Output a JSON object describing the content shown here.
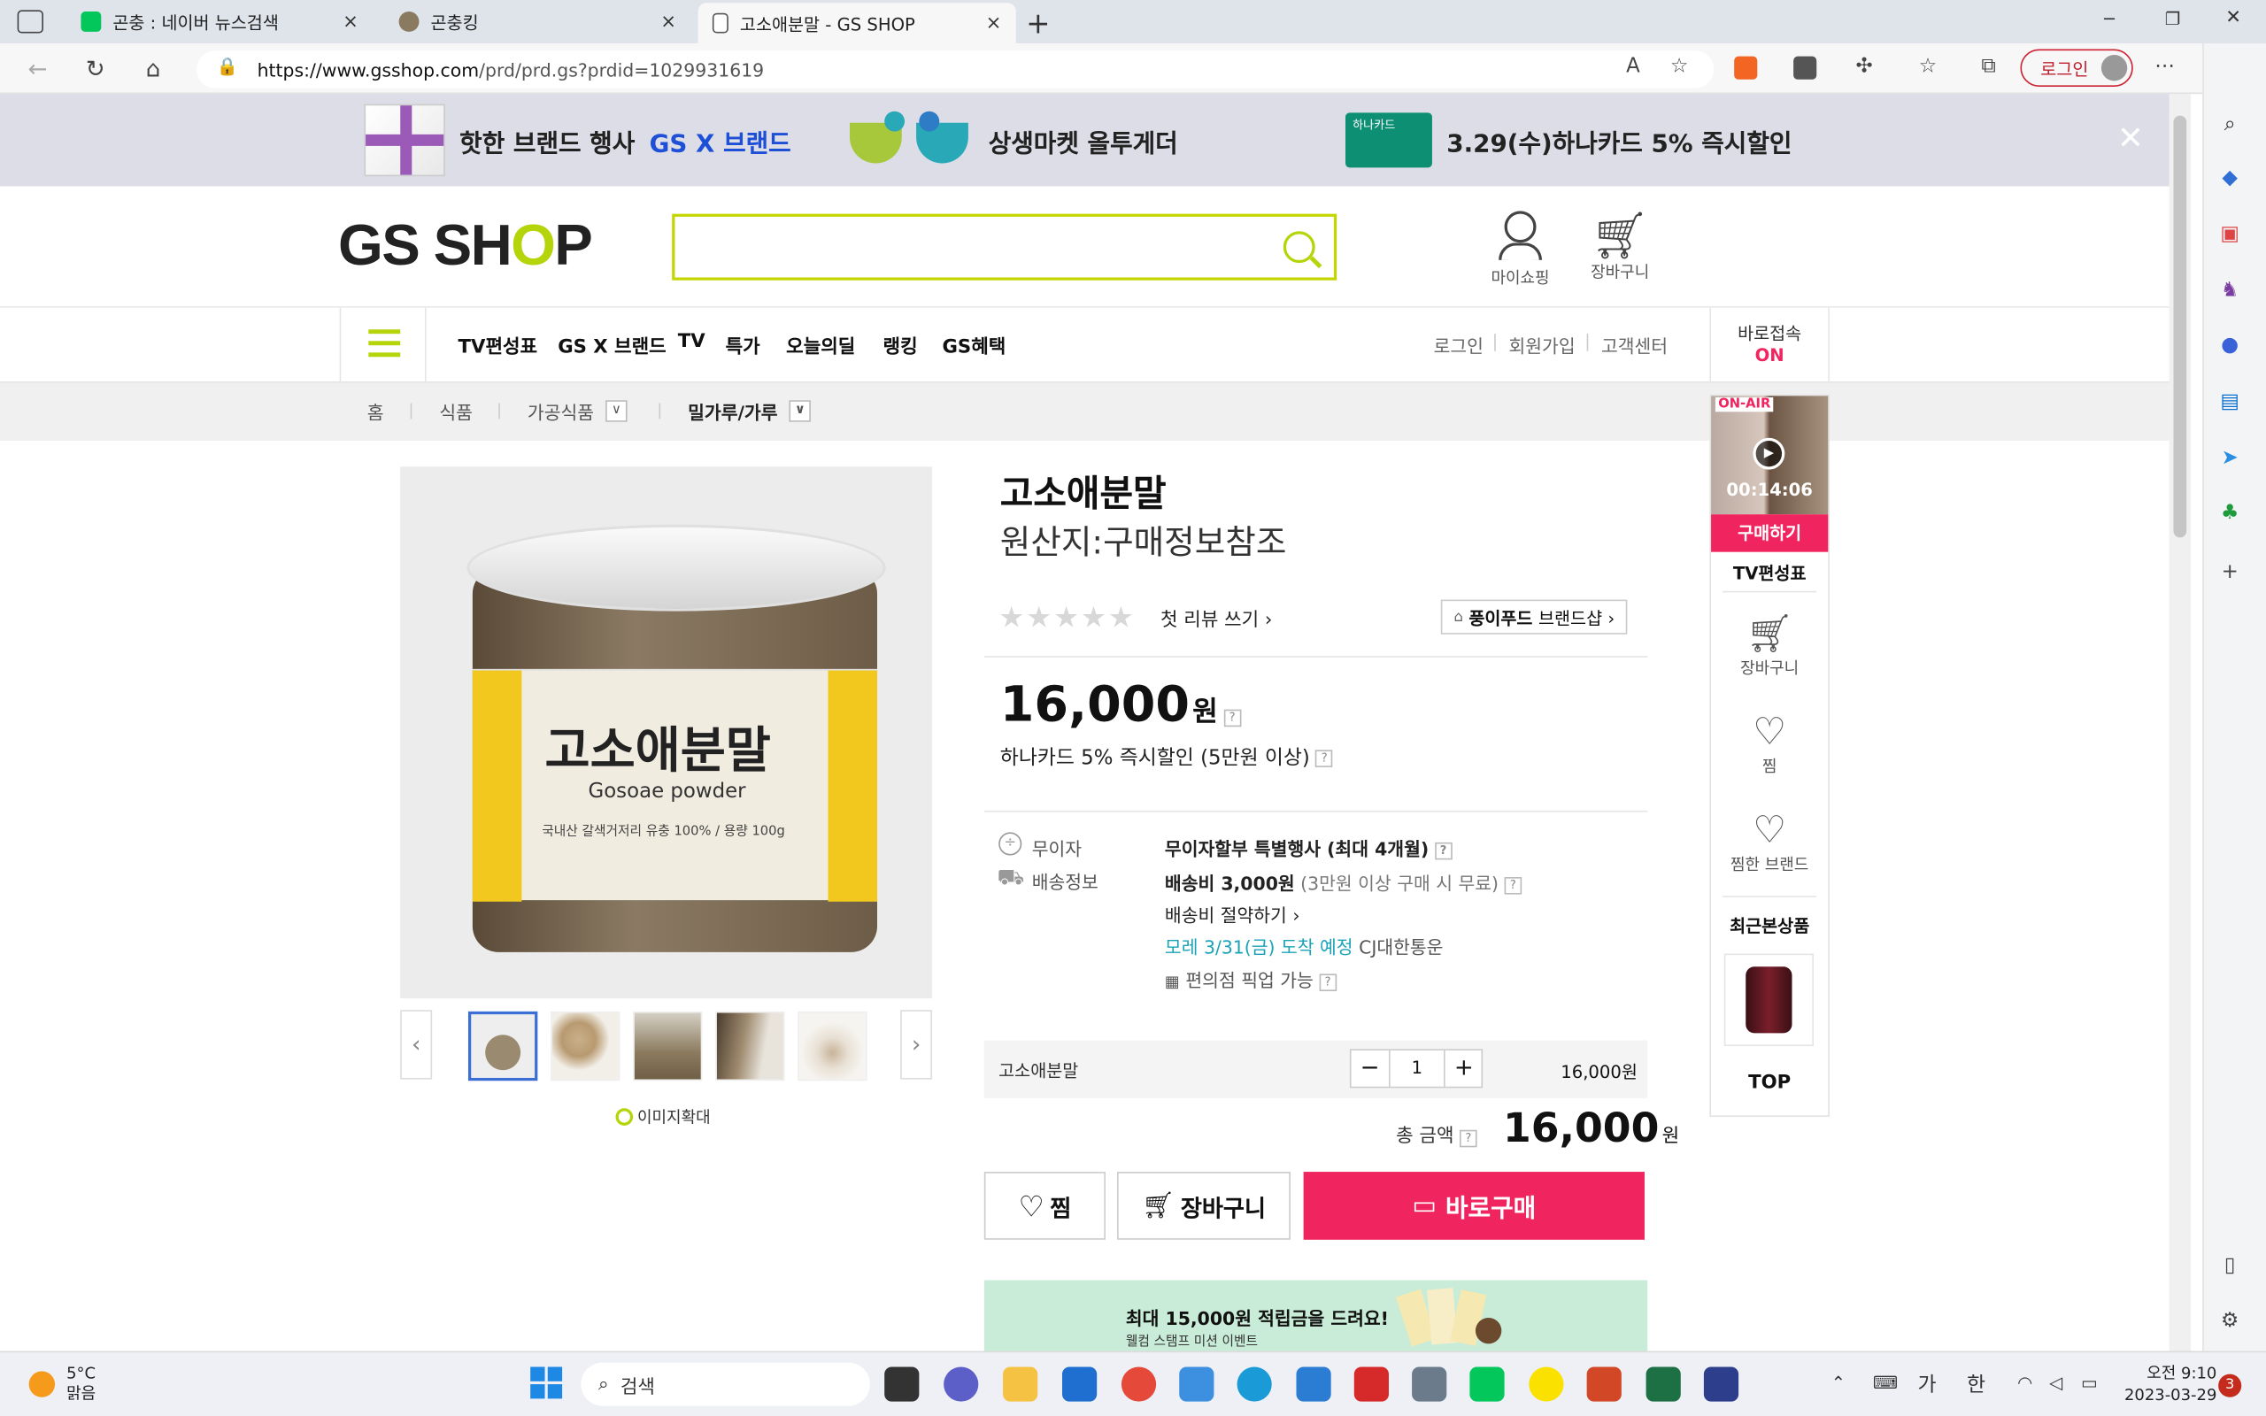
{
  "browser": {
    "tabs": [
      {
        "title": "곤충 : 네이버 뉴스검색",
        "close": "×"
      },
      {
        "title": "곤충킹",
        "close": "×"
      },
      {
        "title": "고소애분말 - GS SHOP",
        "close": "×"
      }
    ],
    "new_tab": "+",
    "url_domain": "https://www.gsshop.com",
    "url_path": "/prd/prd.gs?prdid=1029931619",
    "login_label": "로그인",
    "window_controls": {
      "minimize": "─",
      "restore": "❐",
      "close": "✕"
    }
  },
  "promo_bar": {
    "items": [
      {
        "label": "핫한 브랜드 행사",
        "accent": "GS X 브랜드"
      },
      {
        "label": "상생마켓 올투게더"
      },
      {
        "card": "하나카드",
        "label": "3.29(수)하나카드 5% 즉시할인"
      }
    ],
    "close": "✕"
  },
  "header": {
    "logo_pre": "GS SH",
    "logo_o": "O",
    "logo_post": "P",
    "search_placeholder": "",
    "my_shopping": "마이쇼핑",
    "cart": "장바구니"
  },
  "gnb": {
    "items": [
      "TV편성표",
      "GS X 브랜드",
      "TV",
      "특가",
      "오늘의딜",
      "랭킹",
      "GS혜택"
    ],
    "util": [
      "로그인",
      "회원가입",
      "고객센터"
    ],
    "direct_label": "바로접속",
    "direct_state": "ON"
  },
  "breadcrumb": {
    "items": [
      "홈",
      "식품",
      "가공식품",
      "밀가루/가루"
    ],
    "dropdown": "∨"
  },
  "product": {
    "name": "고소애분말",
    "origin": "원산지:구매정보참조",
    "review_link": "첫 리뷰 쓰기 ›",
    "brand_shop": "풍이푸드",
    "brand_shop_suffix": "브랜드샵 ›",
    "price": "16,000",
    "price_unit": "원",
    "card_discount": "하나카드 5% 즉시할인 (5만원 이상)",
    "jar_title": "고소애분말",
    "jar_sub": "Gosoae powder",
    "jar_desc": "국내산 갈색거저리 유충 100% / 용량 100g",
    "zoom_label": "이미지확대",
    "info": {
      "installment_label": "무이자",
      "installment_value": "무이자할부 특별행사 (최대 4개월)",
      "shipping_label": "배송정보",
      "shipping_fee": "배송비 3,000원",
      "shipping_free": "(3만원 이상 구매 시 무료)",
      "shipping_save": "배송비 절약하기 ›",
      "arrival_highlight": "모레 3/31(금) 도착 예정",
      "arrival_carrier": "CJ대한통운",
      "pickup": "편의점 픽업 가능"
    },
    "option": {
      "name": "고소애분말",
      "qty": "1",
      "minus": "−",
      "plus": "+",
      "price": "16,000원"
    },
    "total_label": "총 금액",
    "total_value": "16,000",
    "total_unit": "원",
    "buttons": {
      "wish": "찜",
      "cart": "장바구니",
      "buy": "바로구매"
    },
    "banner_title": "최대 15,000원 적립금을 드려요!",
    "banner_sub": "웰컴 스탬프 미션 이벤트"
  },
  "rail": {
    "onair": "ON-AIR",
    "timer": "00:14:06",
    "buy": "구매하기",
    "tv_schedule": "TV편성표",
    "cart": "장바구니",
    "wish": "찜",
    "wish_brand": "찜한 브랜드",
    "recent": "최근본상품",
    "top": "TOP"
  },
  "taskbar": {
    "weather_temp": "5°C",
    "weather_desc": "맑음",
    "search": "검색",
    "time": "오전 9:10",
    "date": "2023-03-29",
    "ime1": "가",
    "ime2": "한",
    "notif": "3"
  },
  "colors": {
    "gs_green": "#b6d40a",
    "buy_pink": "#f0245e",
    "arrival_teal": "#1aa3b8",
    "brand_blue": "#1d4fd7"
  }
}
